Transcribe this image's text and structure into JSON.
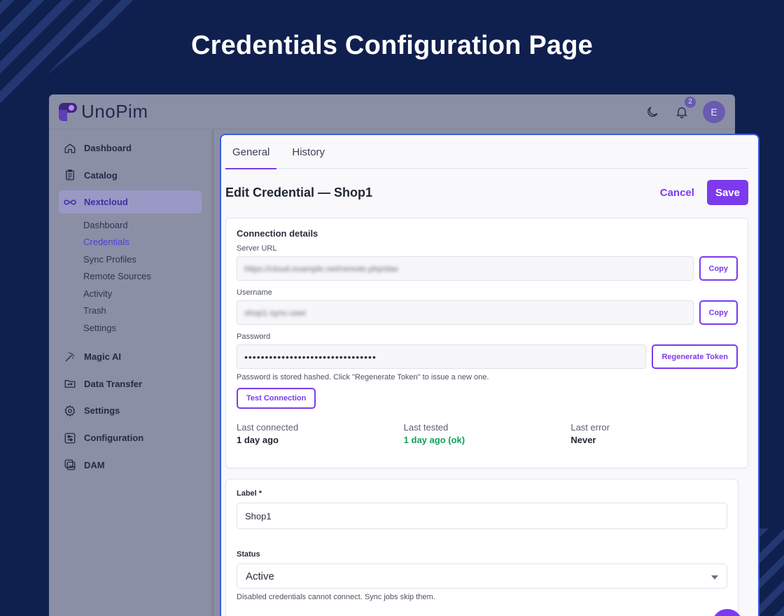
{
  "headline": "Credentials Configuration Page",
  "app": {
    "brand": "UnoPim",
    "notification_count": "2",
    "avatar_initial": "E"
  },
  "sidebar": {
    "items": [
      {
        "label": "Dashboard",
        "icon": "home-icon"
      },
      {
        "label": "Catalog",
        "icon": "clipboard-icon"
      },
      {
        "label": "Nextcloud",
        "icon": "infinity-icon",
        "active": true
      },
      {
        "label": "Magic AI",
        "icon": "magic-wand-icon"
      },
      {
        "label": "Data Transfer",
        "icon": "folder-transfer-icon"
      },
      {
        "label": "Settings",
        "icon": "gear-icon"
      },
      {
        "label": "Configuration",
        "icon": "sliders-icon"
      },
      {
        "label": "DAM",
        "icon": "images-icon"
      }
    ],
    "nextcloud_sub": [
      "Dashboard",
      "Credentials",
      "Sync Profiles",
      "Remote Sources",
      "Activity",
      "Trash",
      "Settings"
    ]
  },
  "tabs": [
    "General",
    "History"
  ],
  "header": {
    "title": "Edit Credential — Shop1",
    "cancel": "Cancel",
    "save": "Save"
  },
  "connection": {
    "title": "Connection details",
    "server_url": {
      "label": "Server URL",
      "value": "https://cloud.example.net/remote.php/dav",
      "button": "Copy"
    },
    "username": {
      "label": "Username",
      "value": "shop1-sync-user",
      "button": "Copy"
    },
    "password": {
      "label": "Password",
      "value": "••••••••••••••••••••••••••••••••",
      "button": "Regenerate Token"
    },
    "hint": "Password is stored hashed. Click \"Regenerate Token\" to issue a new one.",
    "test_button": "Test Connection",
    "meta": {
      "last_connected": {
        "label": "Last connected",
        "value": "1 day ago"
      },
      "last_tested": {
        "label": "Last tested",
        "value": "1 day ago (ok)"
      },
      "last_error": {
        "label": "Last error",
        "value": "Never"
      }
    }
  },
  "form": {
    "label_field": {
      "label": "Label *",
      "value": "Shop1"
    },
    "status_field": {
      "label": "Status",
      "value": "Active",
      "hint": "Disabled credentials cannot connect. Sync jobs skip them."
    }
  },
  "colors": {
    "accent": "#7c3aed",
    "ok": "#10a05a",
    "frame": "#3b5ce0",
    "background": "#10204e"
  }
}
